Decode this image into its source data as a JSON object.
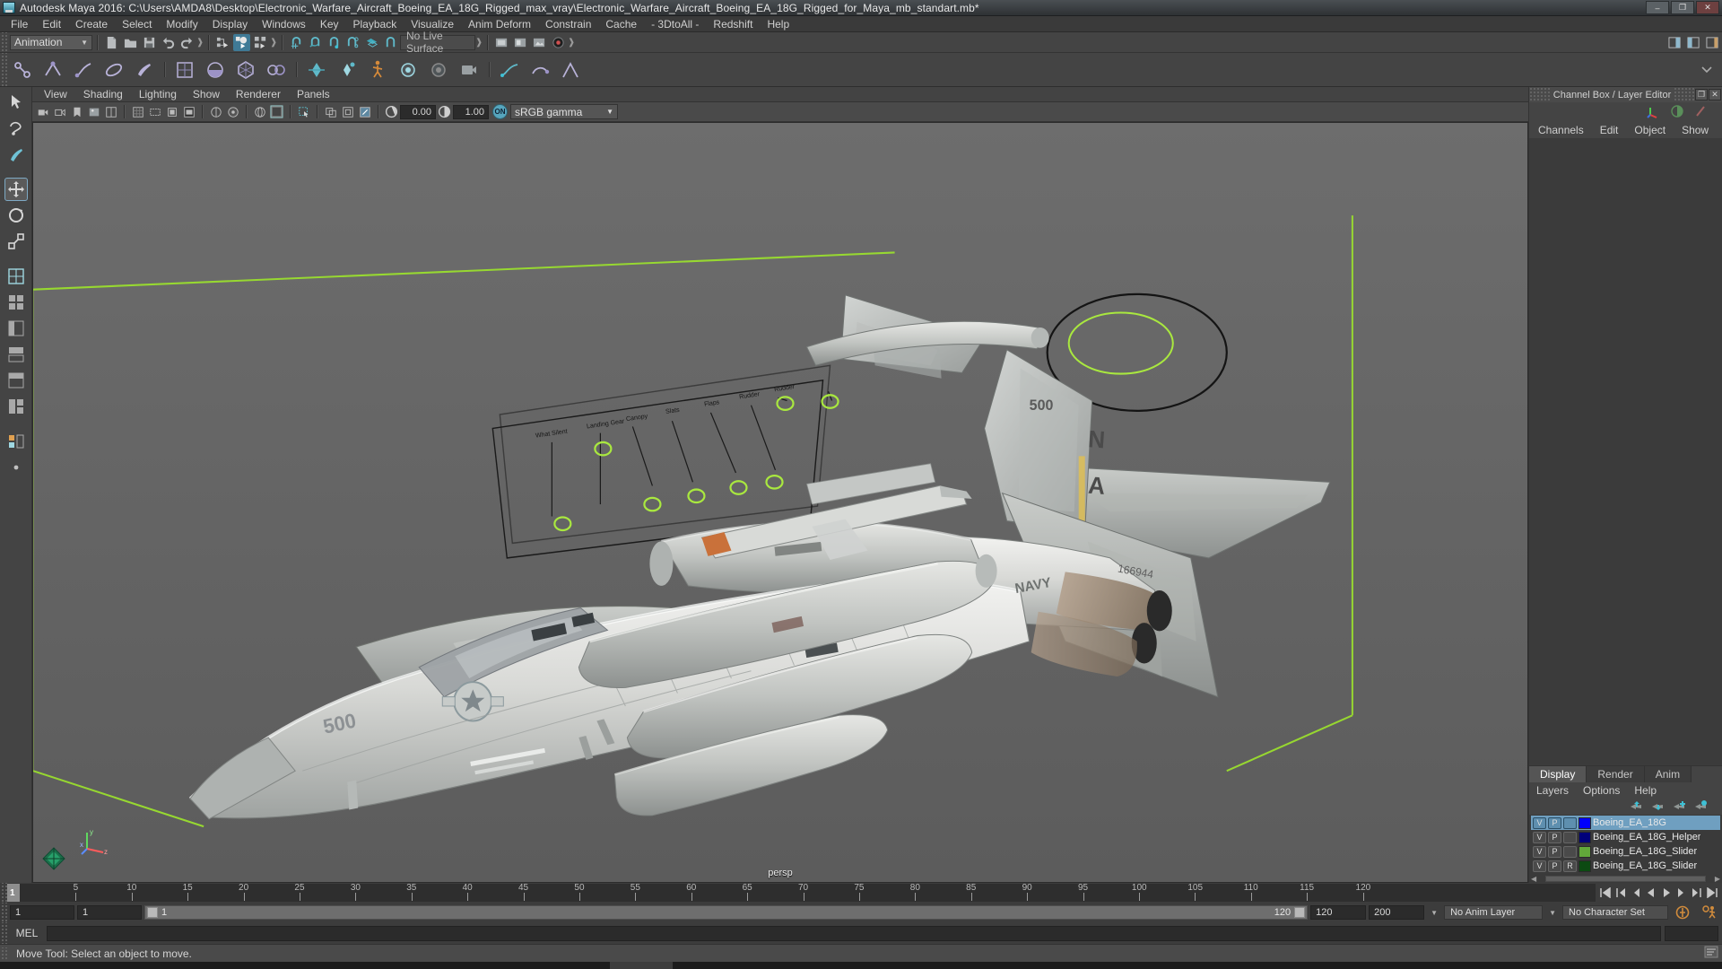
{
  "window": {
    "title": "Autodesk Maya 2016: C:\\Users\\AMDA8\\Desktop\\Electronic_Warfare_Aircraft_Boeing_EA_18G_Rigged_max_vray\\Electronic_Warfare_Aircraft_Boeing_EA_18G_Rigged_for_Maya_mb_standart.mb*",
    "minimize": "–",
    "maximize": "❐",
    "close": "✕"
  },
  "menubar": {
    "items": [
      "File",
      "Edit",
      "Create",
      "Select",
      "Modify",
      "Display",
      "Windows",
      "Key",
      "Playback",
      "Visualize",
      "Anim Deform",
      "Constrain",
      "Cache",
      "- 3DtoAll -",
      "Redshift",
      "Help"
    ]
  },
  "status_toolbar": {
    "menu_set": "Animation",
    "live_surface": "No Live Surface"
  },
  "viewport_menu": {
    "items": [
      "View",
      "Shading",
      "Lighting",
      "Show",
      "Renderer",
      "Panels"
    ]
  },
  "viewport_toolbar": {
    "exposure": "0.00",
    "gamma": "1.00",
    "color_toggle": "ON",
    "color_profile": "sRGB gamma"
  },
  "viewport": {
    "camera_label": "persp",
    "axis_x": "x",
    "axis_y": "y",
    "axis_z": "z",
    "annotations": [
      "What Silent",
      "Landing Gear",
      "Canopy",
      "Slats",
      "Flaps",
      "Rudder",
      "Rudder"
    ],
    "model_markings": [
      "500",
      "NAVY",
      "NA",
      "166944",
      "500"
    ]
  },
  "right_panel": {
    "title": "Channel Box / Layer Editor",
    "undock": "❐",
    "close": "✕",
    "tabs": [
      "Channels",
      "Edit",
      "Object",
      "Show"
    ]
  },
  "layer_editor": {
    "tabs": [
      "Display",
      "Render",
      "Anim"
    ],
    "active_tab": "Display",
    "menu": [
      "Layers",
      "Options",
      "Help"
    ],
    "layers": [
      {
        "v": "V",
        "p": "P",
        "r": "",
        "color": "#0000ff",
        "name": "Boeing_EA_18G",
        "selected": true
      },
      {
        "v": "V",
        "p": "P",
        "r": "",
        "color": "#00007a",
        "name": "Boeing_EA_18G_Helper",
        "selected": false
      },
      {
        "v": "V",
        "p": "P",
        "r": "",
        "color": "#62a83a",
        "name": "Boeing_EA_18G_Slider",
        "selected": false
      },
      {
        "v": "V",
        "p": "P",
        "r": "R",
        "color": "#0c4a12",
        "name": "Boeing_EA_18G_Slider",
        "selected": false
      }
    ]
  },
  "timeline": {
    "ticks": [
      {
        "label": "5",
        "frame": 5
      },
      {
        "label": "10",
        "frame": 10
      },
      {
        "label": "15",
        "frame": 15
      },
      {
        "label": "20",
        "frame": 20
      },
      {
        "label": "25",
        "frame": 25
      },
      {
        "label": "30",
        "frame": 30
      },
      {
        "label": "35",
        "frame": 35
      },
      {
        "label": "40",
        "frame": 40
      },
      {
        "label": "45",
        "frame": 45
      },
      {
        "label": "50",
        "frame": 50
      },
      {
        "label": "55",
        "frame": 55
      },
      {
        "label": "60",
        "frame": 60
      },
      {
        "label": "65",
        "frame": 65
      },
      {
        "label": "70",
        "frame": 70
      },
      {
        "label": "75",
        "frame": 75
      },
      {
        "label": "80",
        "frame": 80
      },
      {
        "label": "85",
        "frame": 85
      },
      {
        "label": "90",
        "frame": 90
      },
      {
        "label": "95",
        "frame": 95
      },
      {
        "label": "100",
        "frame": 100
      },
      {
        "label": "105",
        "frame": 105
      },
      {
        "label": "110",
        "frame": 110
      },
      {
        "label": "115",
        "frame": 115
      },
      {
        "label": "120",
        "frame": 120
      }
    ],
    "current_frame": "1",
    "range_start": "1",
    "range_end": "120",
    "current_frame_field": "1"
  },
  "range_slider": {
    "anim_start": "1",
    "range_start": "1",
    "slider_value": "1",
    "range_end": "120",
    "anim_end": "120",
    "playback_end": "200",
    "anim_layer": "No Anim Layer",
    "character_set": "No Character Set"
  },
  "command_line": {
    "language": "MEL",
    "input_value": "",
    "placeholder": ""
  },
  "status_line": {
    "message": "Move Tool: Select an object to move."
  },
  "colors": {
    "accent": "#3f7a96",
    "selection": "#6f9fc0",
    "viewport_bg": "#636363",
    "grid_line": "#9ade2e",
    "panel_bg": "#444444"
  }
}
